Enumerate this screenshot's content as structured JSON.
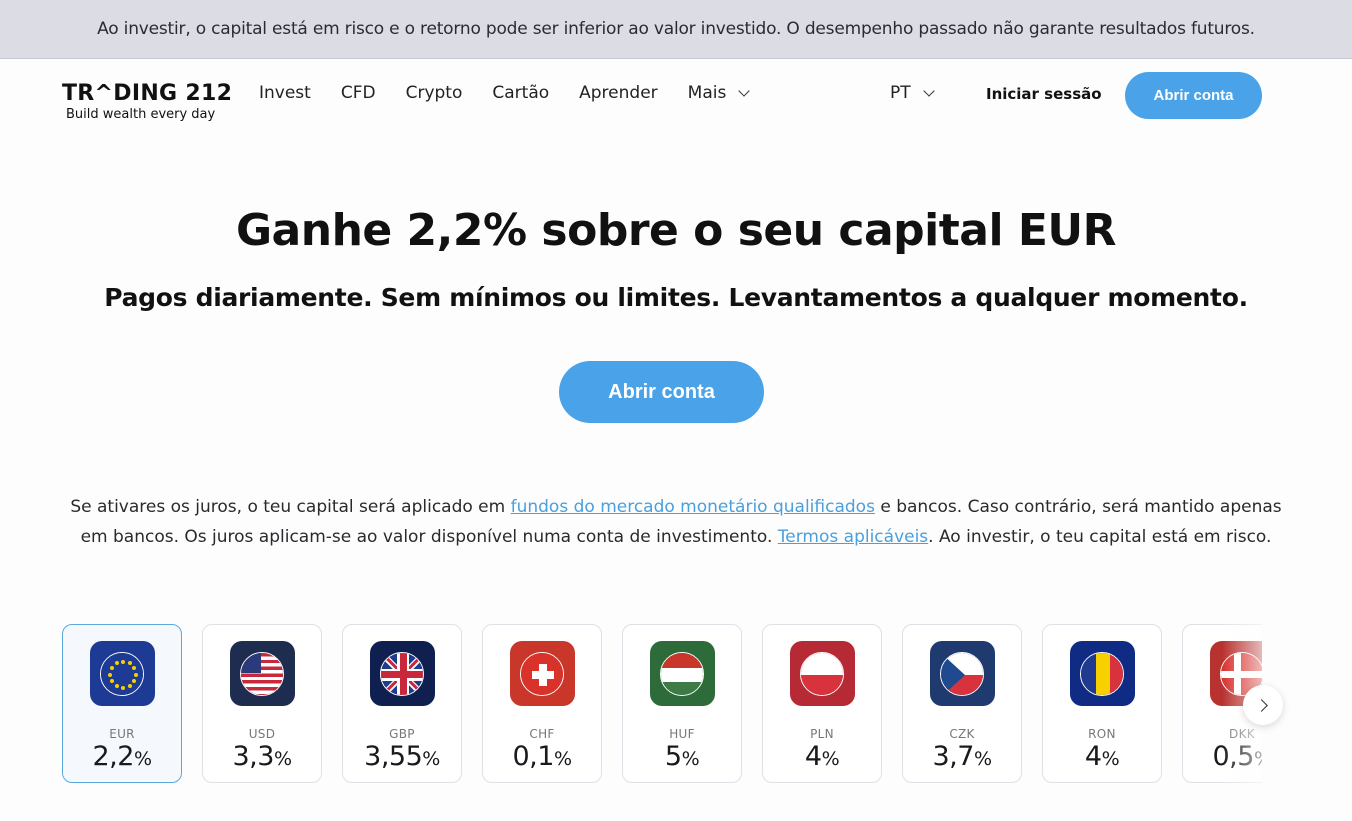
{
  "risk_banner": "Ao investir, o capital está em risco e o retorno pode ser inferior ao valor investido. O desempenho passado não garante resultados futuros.",
  "logo": {
    "name": "TR^DING 212",
    "tagline": "Build wealth every day"
  },
  "nav": {
    "items": [
      "Invest",
      "CFD",
      "Crypto",
      "Cartão",
      "Aprender",
      "Mais"
    ],
    "language": "PT",
    "login": "Iniciar sessão",
    "open_account": "Abrir conta"
  },
  "hero": {
    "title": "Ganhe 2,2% sobre o seu capital EUR",
    "subtitle": "Pagos diariamente. Sem mínimos ou limites. Levantamentos a qualquer momento.",
    "cta": "Abrir conta"
  },
  "info": {
    "part1": "Se ativares os juros, o teu capital será aplicado em ",
    "link1": "fundos do mercado monetário qualificados",
    "part2": " e bancos. Caso contrário, será mantido apenas em bancos. Os juros aplicam-se ao valor disponível numa conta de investimento. ",
    "link2": "Termos aplicáveis",
    "part3": ". Ao investir, o teu capital está em risco."
  },
  "currencies": [
    {
      "code": "EUR",
      "rate": "2,2",
      "unit": "%",
      "color": "#1d3a94",
      "active": true
    },
    {
      "code": "USD",
      "rate": "3,3",
      "unit": "%",
      "color": "#1e2c4f"
    },
    {
      "code": "GBP",
      "rate": "3,55",
      "unit": "%",
      "color": "#0f1f4f"
    },
    {
      "code": "CHF",
      "rate": "0,1",
      "unit": "%",
      "color": "#c8372a"
    },
    {
      "code": "HUF",
      "rate": "5",
      "unit": "%",
      "color": "#2e6b3b"
    },
    {
      "code": "PLN",
      "rate": "4",
      "unit": "%",
      "color": "#b52a35"
    },
    {
      "code": "CZK",
      "rate": "3,7",
      "unit": "%",
      "color": "#1f3a6e"
    },
    {
      "code": "RON",
      "rate": "4",
      "unit": "%",
      "color": "#102b84"
    },
    {
      "code": "DKK",
      "rate": "0,5",
      "unit": "%",
      "color": "#b8322f"
    }
  ]
}
